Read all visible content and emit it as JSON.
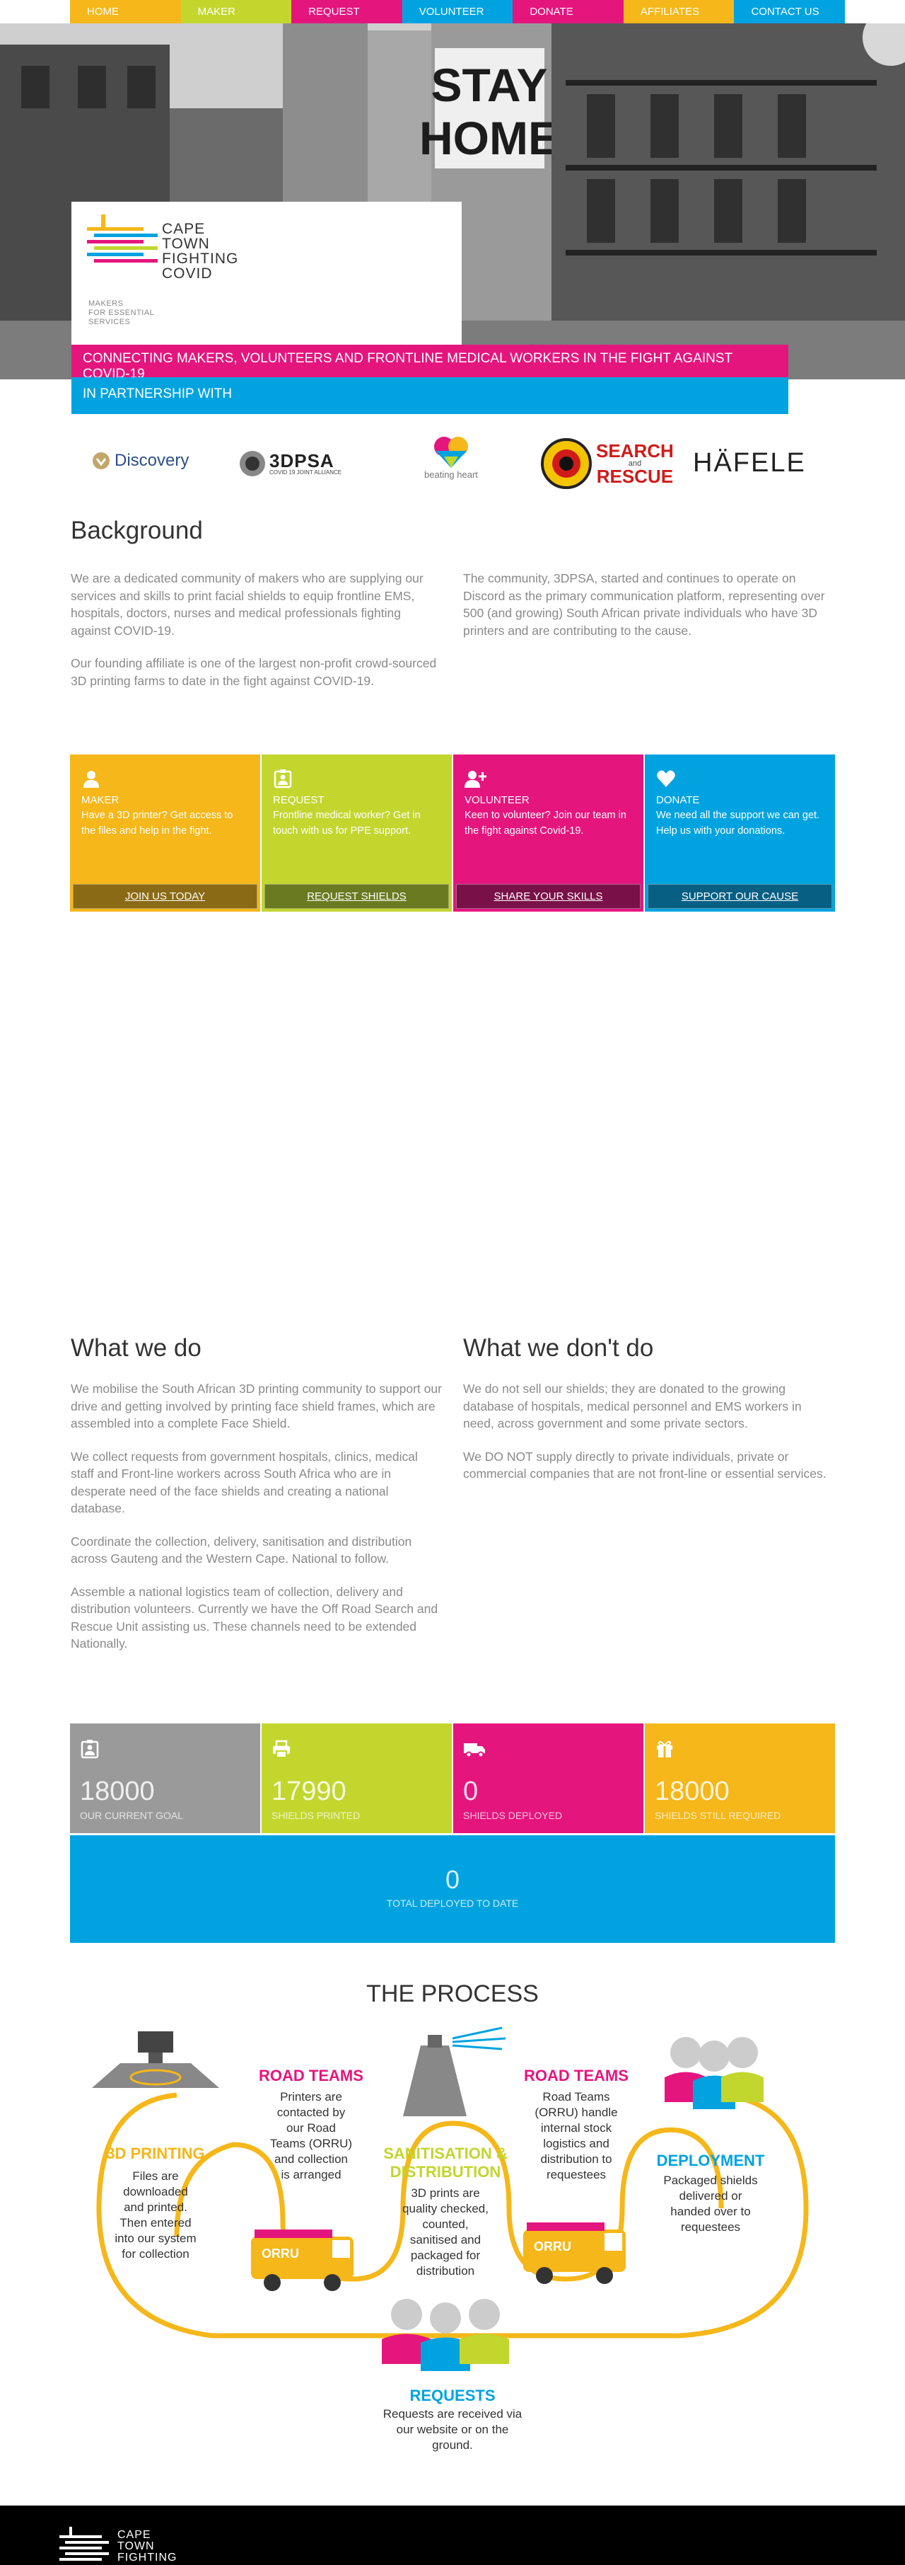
{
  "nav": [
    {
      "label": "HOME",
      "color": "#f5b719"
    },
    {
      "label": "MAKER",
      "color": "#c2d62e"
    },
    {
      "label": "REQUEST",
      "color": "#e5157e"
    },
    {
      "label": "VOLUNTEER",
      "color": "#00a3e0"
    },
    {
      "label": "DONATE",
      "color": "#e5157e"
    },
    {
      "label": "AFFILIATES",
      "color": "#f5b719"
    },
    {
      "label": "CONTACT US",
      "color": "#00a3e0"
    }
  ],
  "hero": {
    "sign_text": "STAY HOME",
    "logo_title": "CAPE\nTOWN\nFIGHTING\nCOVID",
    "logo_sub": "MAKERS\nFOR ESSENTIAL\nSERVICES",
    "tagline": "CONNECTING MAKERS, VOLUNTEERS AND FRONTLINE MEDICAL WORKERS IN THE FIGHT AGAINST COVID-19",
    "partnership": "IN PARTNERSHIP WITH"
  },
  "partners": {
    "discovery": "Discovery",
    "threedpsa": "3DPSA",
    "threedpsa_sub": "COVID 19 JOINT ALLIANCE",
    "beating_heart": "beating heart",
    "sar_1": "SEARCH",
    "sar_and": "and",
    "sar_2": "RESCUE",
    "hafele": "HÄFELE"
  },
  "background": {
    "heading": "Background",
    "left_p1": "We are a dedicated community of makers who are supplying our services and skills to print facial shields to equip frontline EMS, hospitals, doctors, nurses and medical professionals fighting against COVID-19.",
    "left_p2": "Our founding affiliate is one of the largest non-profit crowd-sourced 3D printing farms to date in the fight against COVID-19.",
    "right_p1": "The community, 3DPSA, started and continues to operate on Discord as the primary communication platform, representing over 500 (and growing) South African private individuals who have 3D printers and are contributing to the cause."
  },
  "cards": [
    {
      "title": "MAKER",
      "desc": "Have a 3D printer? Get access to the files and help in the fight.",
      "button": "JOIN US TODAY",
      "color": "#f5b719",
      "btn_color": "#8a6a14",
      "icon": "user-icon"
    },
    {
      "title": "REQUEST",
      "desc": "Frontline medical worker? Get in touch with us for PPE support.",
      "button": "REQUEST SHIELDS",
      "color": "#c2d62e",
      "btn_color": "#6a7a20",
      "icon": "id-card-icon"
    },
    {
      "title": "VOLUNTEER",
      "desc": "Keen to volunteer? Join our team in the fight against Covid-19.",
      "button": "SHARE YOUR SKILLS",
      "color": "#e5157e",
      "btn_color": "#7a1048",
      "icon": "user-plus-icon"
    },
    {
      "title": "DONATE",
      "desc": "We need all the support we can get. Help us with your donations.",
      "button": "SUPPORT OUR CAUSE",
      "color": "#00a3e0",
      "btn_color": "#075f84",
      "icon": "heart-icon"
    }
  ],
  "what_we_do": {
    "heading": "What we do",
    "paragraphs": [
      "We mobilise the South African 3D printing community to support our drive and getting involved by printing face shield frames, which are assembled into a complete Face Shield.",
      "We collect requests from government hospitals, clinics, medical staff and Front-line workers across South Africa who are in desperate need of the face shields and creating a national database.",
      "Coordinate the collection, delivery, sanitisation and distribution across Gauteng and the Western Cape. National to follow.",
      "Assemble a national logistics team of collection, delivery and distribution volunteers. Currently we have the Off Road Search and Rescue Unit assisting us. These channels need to be extended Nationally."
    ]
  },
  "what_we_dont": {
    "heading": "What we don't do",
    "paragraphs": [
      "We do not sell our shields; they are donated to the growing database of hospitals, medical personnel and EMS workers in need, across government and some private sectors.",
      "We DO NOT supply directly to private individuals, private or commercial companies that are not front-line or essential services."
    ]
  },
  "stats": [
    {
      "value": "18000",
      "label": "OUR CURRENT GOAL",
      "color": "#9a9a9a",
      "icon": "id-card-icon"
    },
    {
      "value": "17990",
      "label": "SHIELDS PRINTED",
      "color": "#c2d62e",
      "icon": "printer-icon"
    },
    {
      "value": "0",
      "label": "SHIELDS DEPLOYED",
      "color": "#e5157e",
      "icon": "truck-icon"
    },
    {
      "value": "18000",
      "label": "SHIELDS STILL REQUIRED",
      "color": "#f5b719",
      "icon": "gift-icon"
    }
  ],
  "total": {
    "value": "0",
    "label": "TOTAL DEPLOYED TO DATE"
  },
  "process": {
    "title": "THE PROCESS",
    "steps": [
      {
        "heading": "3D PRINTING",
        "text": "Files are\ndownloaded\nand printed.\nThen entered\ninto our system\nfor collection",
        "color": "#f5b719"
      },
      {
        "heading": "ROAD TEAMS",
        "text": "Printers are\ncontacted by\nour Road\nTeams (ORRU)\nand collection\nis arranged",
        "color": "#e5157e"
      },
      {
        "heading": "SANITISATION &\nDISTRIBUTION",
        "text": "3D prints are\nquality checked,\ncounted,\nsanitised and\npackaged for\ndistribution",
        "color": "#c2d62e"
      },
      {
        "heading": "ROAD TEAMS",
        "text": "Road Teams\n(ORRU) handle\ninternal stock\nlogistics and\ndistribution to\nrequestees",
        "color": "#e5157e"
      },
      {
        "heading": "DEPLOYMENT",
        "text": "Packaged shields\ndelivered or\nhanded over to\nrequestees",
        "color": "#00a3e0"
      },
      {
        "heading": "REQUESTS",
        "text": "Requests are received via\nour website or on the\nground.",
        "color": "#00a3e0"
      }
    ],
    "van_label": "ORRU"
  },
  "footer": {
    "logo_title": "CAPE\nTOWN\nFIGHTING"
  }
}
